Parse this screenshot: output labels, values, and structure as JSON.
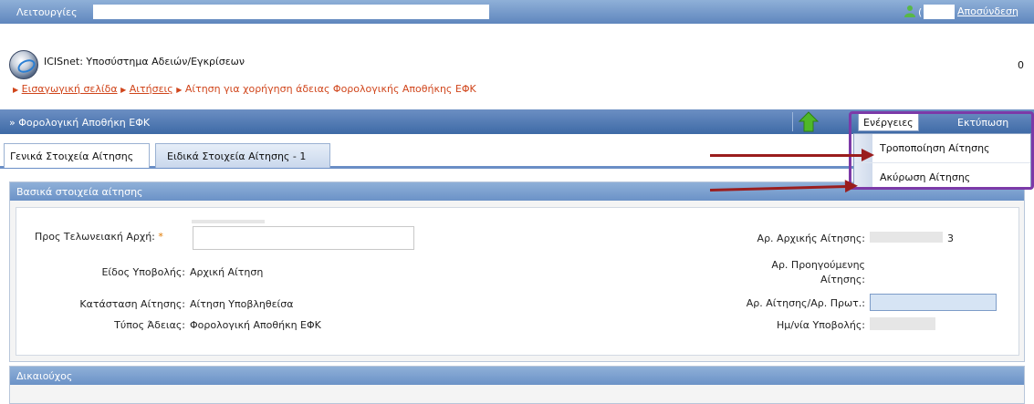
{
  "topbar": {
    "menu_label": "Λειτουργίες",
    "user_paren": "(",
    "logout_label": "Αποσύνδεση"
  },
  "header": {
    "app_title": "ICISnet: Υποσύστημα Αδειών/Εγκρίσεων",
    "counter": "0"
  },
  "breadcrumb": {
    "home": "Εισαγωγική σελίδα",
    "applications": "Αιτήσεις",
    "current": "Αίτηση για χορήγηση άδειας Φορολογικής Αποθήκης ΕΦΚ"
  },
  "panel": {
    "title": "» Φορολογική Αποθήκη ΕΦΚ",
    "actions_label": "Ενέργειες",
    "print_label": "Εκτύπωση"
  },
  "tabs": [
    {
      "label": "Γενικά Στοιχεία Αίτησης"
    },
    {
      "label": "Ειδικά Στοιχεία Αίτησης - 1"
    }
  ],
  "actions_menu": {
    "items": [
      {
        "label": "Τροποποίηση Αίτησης"
      },
      {
        "label": "Ακύρωση Αίτησης"
      }
    ]
  },
  "basic": {
    "title": "Βασικά στοιχεία αίτησης",
    "customs_authority_label": "Προς Τελωνειακή Αρχή:",
    "required_mark": "*",
    "submission_type_label": "Είδος Υποβολής:",
    "submission_type_value": "Αρχική Αίτηση",
    "status_label": "Κατάσταση Αίτησης:",
    "status_value": "Αίτηση Υποβληθείσα",
    "license_type_label": "Τύπος Άδειας:",
    "license_type_value": "Φορολογική Αποθήκη ΕΦΚ",
    "initial_app_label": "Αρ. Αρχικής Αίτησης:",
    "initial_app_suffix": "3",
    "previous_app_label_1": "Αρ. Προηγούμενης",
    "previous_app_label_2": "Αίτησης:",
    "app_number_label": "Αρ. Αίτησης/Αρ. Πρωτ.:",
    "submission_date_label": "Ημ/νία Υποβολής:"
  },
  "owner": {
    "title": "Δικαιούχος"
  }
}
